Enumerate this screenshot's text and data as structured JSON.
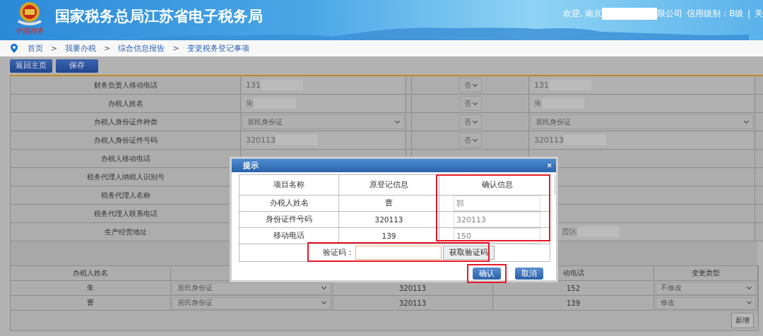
{
  "header": {
    "logo_caption": "中国税务",
    "title": "国家税务总局江苏省电子税务局",
    "welcome_prefix": "欢迎, 南京",
    "welcome_suffix": "限公司",
    "credit": "信用级别：B级",
    "separator": "|",
    "cut_link": "关"
  },
  "breadcrumb": [
    {
      "kind": "link",
      "text": "首页"
    },
    {
      "kind": "sep",
      "text": ">"
    },
    {
      "kind": "link",
      "text": "我要办税"
    },
    {
      "kind": "sep",
      "text": ">"
    },
    {
      "kind": "link",
      "text": "综合信息报告"
    },
    {
      "kind": "sep",
      "text": ">"
    },
    {
      "kind": "link",
      "text": "变更税务登记事项"
    }
  ],
  "toolbar": [
    "返回主页",
    "保存"
  ],
  "form_rows": [
    {
      "label": "财务负责人移动电话",
      "original": {
        "kind": "text",
        "value": "131",
        "redacted": true
      },
      "change": "否",
      "new": {
        "kind": "text",
        "value": "131",
        "redacted": true
      }
    },
    {
      "label": "办税人姓名",
      "original": {
        "kind": "text",
        "value": "朱",
        "redacted": true
      },
      "change": "否",
      "new": {
        "kind": "text",
        "value": "朱",
        "redacted": true
      }
    },
    {
      "label": "办税人身份证件种类",
      "original": {
        "kind": "select",
        "value": "居民身份证"
      },
      "change": "否",
      "new": {
        "kind": "select",
        "value": "居民身份证"
      }
    },
    {
      "label": "办税人身份证件号码",
      "original": {
        "kind": "text",
        "value": "320113",
        "redacted": true
      },
      "change": "否",
      "new": {
        "kind": "text",
        "value": "320113",
        "redacted": true
      }
    },
    {
      "label": "办税人移动电话"
    },
    {
      "label": "税务代理人纳税人识别号"
    },
    {
      "label": "税务代理人名称"
    },
    {
      "label": "税务代理人联系电话"
    },
    {
      "label": "生产经营地址",
      "new": {
        "kind": "covered_text",
        "value": "霞区",
        "redacted": true
      }
    }
  ],
  "agents": {
    "columns": [
      {
        "label": "办税人姓名"
      },
      {},
      {},
      {
        "label": "动电话"
      },
      {
        "label": "变更类型"
      }
    ],
    "rows": [
      {
        "name": "朱",
        "id_type": "居民身份证",
        "id_number": "320113",
        "phone": "152",
        "change_type": "不修改"
      },
      {
        "name": "曹",
        "id_type": "居民身份证",
        "id_number": "320113",
        "phone": "139",
        "change_type": "修改"
      }
    ],
    "add_button": "新增"
  },
  "dialog": {
    "title": "提示",
    "close": "×",
    "columns": [
      "项目名称",
      "原登记信息",
      "确认信息"
    ],
    "rows": [
      {
        "item": "办税人姓名",
        "original": "曹",
        "confirm": "郭"
      },
      {
        "item": "身份证件号码",
        "original": "320113",
        "confirm": "320113"
      },
      {
        "item": "移动电话",
        "original": "139",
        "confirm": "150"
      }
    ],
    "captcha_label": "验证码：",
    "get_code_button": "获取验证码",
    "confirm_column_highlighted": true,
    "captcha_highlighted": true,
    "buttons": [
      {
        "label": "确认",
        "highlighted": true
      },
      {
        "label": "取消",
        "highlighted": false
      }
    ]
  }
}
